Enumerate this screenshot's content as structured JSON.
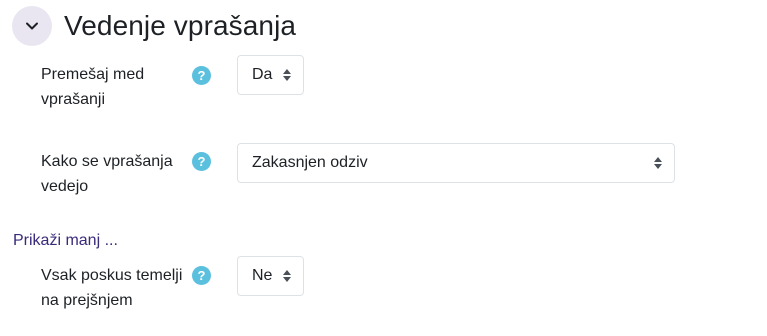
{
  "section": {
    "title": "Vedenje vprašanja"
  },
  "fields": {
    "shuffle": {
      "label": "Premešaj med vprašanji",
      "help_icon": "question-circle-icon",
      "value": "Da"
    },
    "behaviour": {
      "label": "Kako se vprašanja vedejo",
      "help_icon": "question-circle-icon",
      "value": "Zakasnjen odziv"
    },
    "attempt": {
      "label": "Vsak poskus temelji na prejšnjem",
      "help_icon": "question-circle-icon",
      "value": "Ne"
    }
  },
  "show_less_link": "Prikaži manj ...",
  "colors": {
    "toggle_bg": "#e9e6f1",
    "help_icon": "#5bc0de",
    "link": "#3a2a7a",
    "border": "#dee2e6"
  }
}
